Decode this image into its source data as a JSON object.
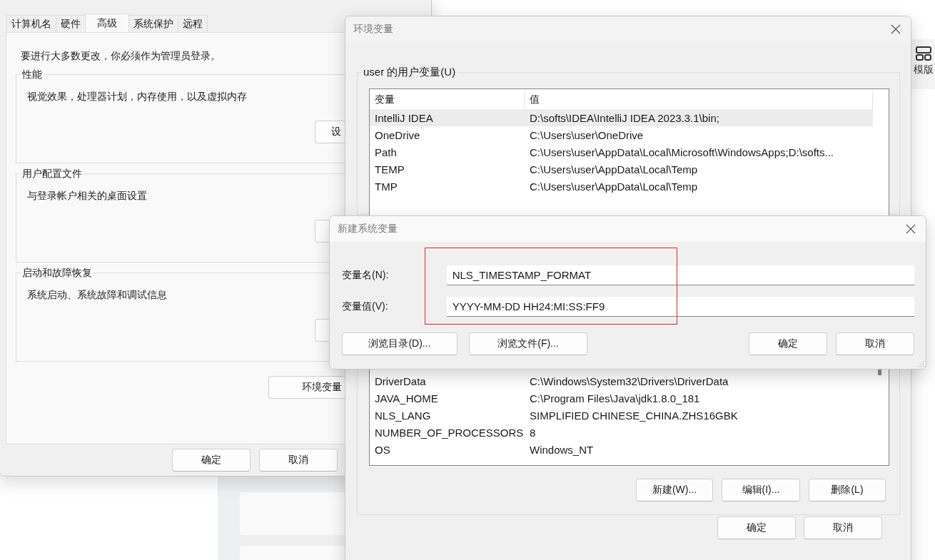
{
  "system_properties": {
    "tabs": [
      {
        "label": "计算机名",
        "selected": false
      },
      {
        "label": "硬件",
        "selected": false
      },
      {
        "label": "高级",
        "selected": true
      },
      {
        "label": "系统保护",
        "selected": false
      },
      {
        "label": "远程",
        "selected": false
      }
    ],
    "notice": "要进行大多数更改，你必须作为管理员登录。",
    "groups": [
      {
        "title": "性能",
        "description": "视觉效果，处理器计划，内存使用，以及虚拟内存",
        "button": "设"
      },
      {
        "title": "用户配置文件",
        "description": "与登录帐户相关的桌面设置"
      },
      {
        "title": "启动和故障恢复",
        "description": "系统启动、系统故障和调试信息"
      }
    ],
    "env_button": "环境变量",
    "buttons": [
      "确定",
      "取消"
    ]
  },
  "env_dialog": {
    "title": "环境变量",
    "user_group": {
      "title": "user 的用户变量(U)",
      "columns": [
        "变量",
        "值"
      ],
      "rows": [
        {
          "name": "IntelliJ IDEA",
          "value": "D:\\softs\\IDEA\\IntelliJ IDEA 2023.3.1\\bin;",
          "selected": true
        },
        {
          "name": "OneDrive",
          "value": "C:\\Users\\user\\OneDrive",
          "selected": false
        },
        {
          "name": "Path",
          "value": "C:\\Users\\user\\AppData\\Local\\Microsoft\\WindowsApps;D:\\softs...",
          "selected": false
        },
        {
          "name": "TEMP",
          "value": "C:\\Users\\user\\AppData\\Local\\Temp",
          "selected": false
        },
        {
          "name": "TMP",
          "value": "C:\\Users\\user\\AppData\\Local\\Temp",
          "selected": false
        }
      ]
    },
    "system_rows": [
      {
        "name": "DriverData",
        "value": "C:\\Windows\\System32\\Drivers\\DriverData"
      },
      {
        "name": "JAVA_HOME",
        "value": "C:\\Program Files\\Java\\jdk1.8.0_181"
      },
      {
        "name": "NLS_LANG",
        "value": "SIMPLIFIED CHINESE_CHINA.ZHS16GBK"
      },
      {
        "name": "NUMBER_OF_PROCESSORS",
        "value": "8"
      },
      {
        "name": "OS",
        "value": "Windows_NT"
      }
    ],
    "system_buttons": [
      "新建(W)...",
      "编辑(I)...",
      "删除(L)"
    ],
    "buttons": [
      "确定",
      "取消"
    ]
  },
  "new_dialog": {
    "title": "新建系统变量",
    "fields": [
      {
        "label": "变量名(N):",
        "value": "NLS_TIMESTAMP_FORMAT"
      },
      {
        "label": "变量值(V):",
        "value": "YYYY-MM-DD HH24:MI:SS:FF9"
      }
    ],
    "left_buttons": [
      "浏览目录(D)...",
      "浏览文件(F)..."
    ],
    "right_buttons": [
      "确定",
      "取消"
    ]
  },
  "side_panel": {
    "label": "模版"
  }
}
